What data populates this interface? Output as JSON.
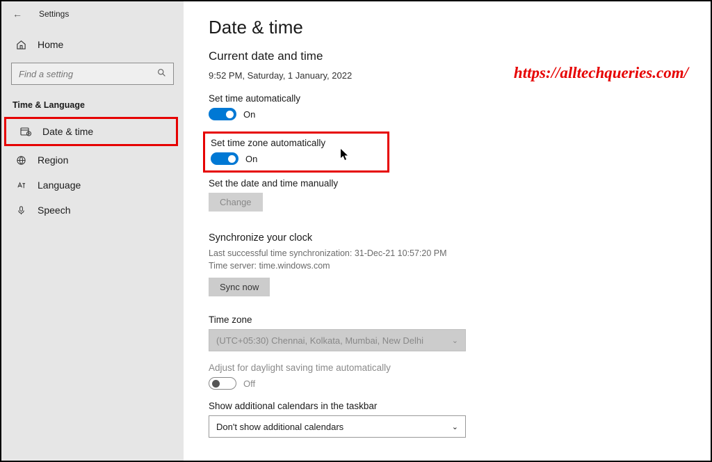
{
  "header": {
    "title": "Settings"
  },
  "sidebar": {
    "home": "Home",
    "search_placeholder": "Find a setting",
    "category": "Time & Language",
    "items": [
      {
        "label": "Date & time"
      },
      {
        "label": "Region"
      },
      {
        "label": "Language"
      },
      {
        "label": "Speech"
      }
    ]
  },
  "main": {
    "title": "Date & time",
    "subtitle": "Current date and time",
    "current_time": "9:52 PM, Saturday, 1 January, 2022",
    "set_time_auto_label": "Set time automatically",
    "set_time_auto_state": "On",
    "set_tz_auto_label": "Set time zone automatically",
    "set_tz_auto_state": "On",
    "set_manual_label": "Set the date and time manually",
    "change_button": "Change",
    "sync_title": "Synchronize your clock",
    "sync_line1": "Last successful time synchronization: 31-Dec-21 10:57:20 PM",
    "sync_line2": "Time server: time.windows.com",
    "sync_button": "Sync now",
    "tz_label": "Time zone",
    "tz_value": "(UTC+05:30) Chennai, Kolkata, Mumbai, New Delhi",
    "dst_label": "Adjust for daylight saving time automatically",
    "dst_state": "Off",
    "cal_label": "Show additional calendars in the taskbar",
    "cal_value": "Don't show additional calendars"
  },
  "watermark": "https://alltechqueries.com/"
}
